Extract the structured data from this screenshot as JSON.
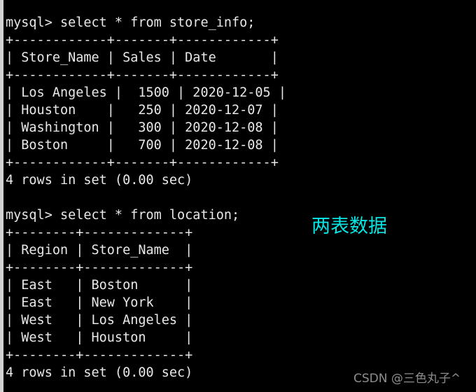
{
  "terminal": {
    "background_color": "#000000",
    "text_color": "#e8e8e8",
    "gutter_color": "#d2d2d2",
    "lines": [
      "mysql> select * from store_info;",
      "+------------+-------+------------+",
      "| Store_Name | Sales | Date       |",
      "+------------+-------+------------+",
      "| Los Angeles |  1500 | 2020-12-05 |",
      "| Houston    |   250 | 2020-12-07 |",
      "| Washington |   300 | 2020-12-08 |",
      "| Boston     |   700 | 2020-12-08 |",
      "+------------+-------+------------+",
      "4 rows in set (0.00 sec)",
      "",
      "mysql> select * from location;",
      "+--------+-------------+",
      "| Region | Store_Name  |",
      "+--------+-------------+",
      "| East   | Boston      |",
      "| East   | New York    |",
      "| West   | Los Angeles |",
      "| West   | Houston     |",
      "+--------+-------------+",
      "4 rows in set (0.00 sec)"
    ]
  },
  "queries": [
    {
      "prompt": "mysql>",
      "sql": "select * from store_info;",
      "table_name": "store_info",
      "columns": [
        "Store_Name",
        "Sales",
        "Date"
      ],
      "rows": [
        [
          "Los Angeles",
          "1500",
          "2020-12-05"
        ],
        [
          "Houston",
          "250",
          "2020-12-07"
        ],
        [
          "Washington",
          "300",
          "2020-12-08"
        ],
        [
          "Boston",
          "700",
          "2020-12-08"
        ]
      ],
      "status": "4 rows in set (0.00 sec)"
    },
    {
      "prompt": "mysql>",
      "sql": "select * from location;",
      "table_name": "location",
      "columns": [
        "Region",
        "Store_Name"
      ],
      "rows": [
        [
          "East",
          "Boston"
        ],
        [
          "East",
          "New York"
        ],
        [
          "West",
          "Los Angeles"
        ],
        [
          "West",
          "Houston"
        ]
      ],
      "status": "4 rows in set (0.00 sec)"
    }
  ],
  "annotation": {
    "text": "两表数据",
    "color": "#06e3e3"
  },
  "watermark": {
    "text": "CSDN @三色丸子^",
    "color": "#8e8e8e"
  }
}
